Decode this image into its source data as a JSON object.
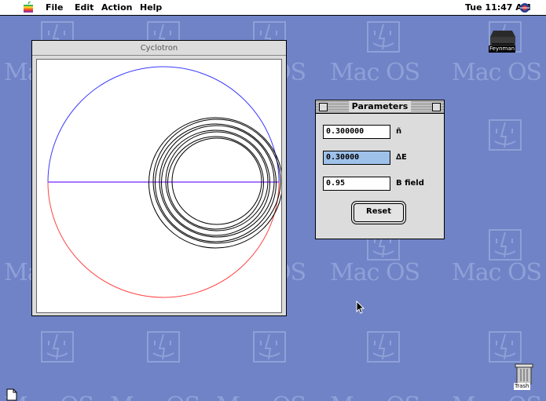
{
  "menubar": {
    "items": [
      "File",
      "Edit",
      "Action",
      "Help"
    ],
    "clock": "Tue 11:47 AM"
  },
  "desktop": {
    "pattern_text": "Mac OS",
    "drive_label": "Feynman",
    "trash_label": "Trash"
  },
  "cyclotron_window": {
    "title": "Cyclotron"
  },
  "parameters_window": {
    "title": "Parameters",
    "fields": [
      {
        "value": "0.300000",
        "label": "ñ"
      },
      {
        "value": "0.30000",
        "label": "∆E"
      },
      {
        "value": "0.95",
        "label": "B field"
      }
    ],
    "reset_label": "Reset"
  },
  "colors": {
    "desktop": "#6f83c6",
    "upper_arc": "#3a3aff",
    "lower_arc": "#ff4444",
    "selection": "#9ec1ea"
  }
}
